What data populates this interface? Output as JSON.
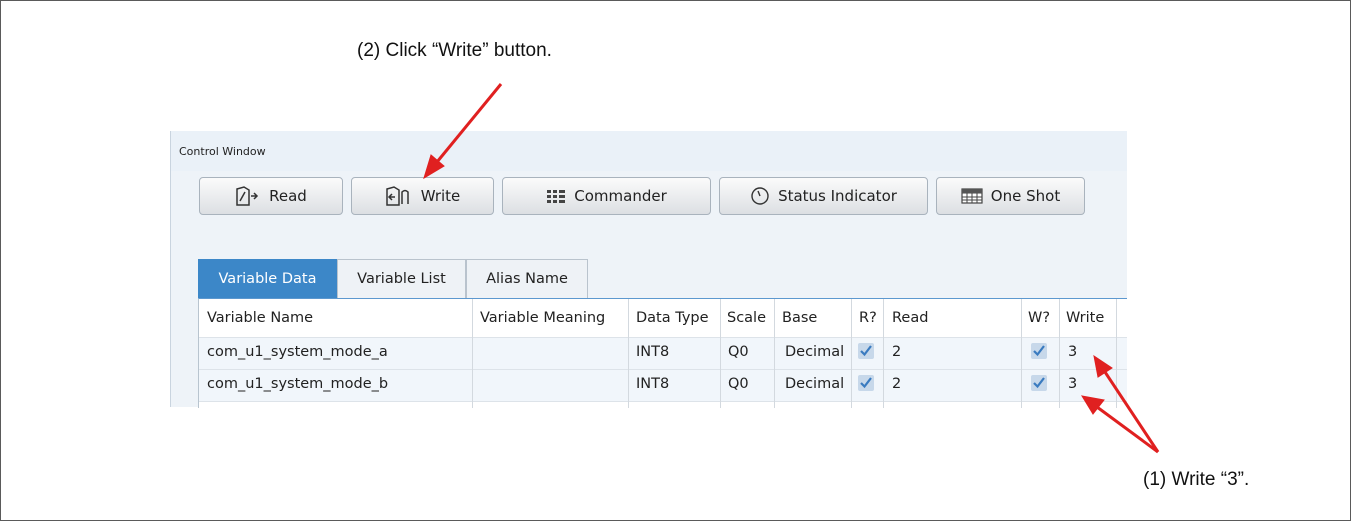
{
  "annotations": {
    "step2": "(2)  Click “Write” button.",
    "step1": "(1)  Write “3”."
  },
  "window": {
    "title": "Control Window"
  },
  "toolbar": {
    "read": "Read",
    "write": "Write",
    "commander": "Commander",
    "status_indicator": "Status Indicator",
    "one_shot": "One Shot"
  },
  "tabs": [
    "Variable Data",
    "Variable List",
    "Alias Name"
  ],
  "table": {
    "headers": [
      "Variable Name",
      "Variable Meaning",
      "Data Type",
      "Scale",
      "Base",
      "R?",
      "Read",
      "W?",
      "Write"
    ],
    "rows": [
      {
        "name": "com_u1_system_mode_a",
        "meaning": "",
        "type": "INT8",
        "scale": "Q0",
        "base": "Decimal",
        "r": true,
        "read": "2",
        "w": true,
        "write": "3"
      },
      {
        "name": "com_u1_system_mode_b",
        "meaning": "",
        "type": "INT8",
        "scale": "Q0",
        "base": "Decimal",
        "r": true,
        "read": "2",
        "w": true,
        "write": "3"
      }
    ]
  },
  "colors": {
    "arrow": "#e02020",
    "tab_active": "#3c87c8",
    "checkbox": "#c7d8ea"
  },
  "icons": {
    "read": "read-icon",
    "write": "write-icon",
    "commander": "grid-icon",
    "status": "clock-icon",
    "one_shot": "table-icon"
  }
}
